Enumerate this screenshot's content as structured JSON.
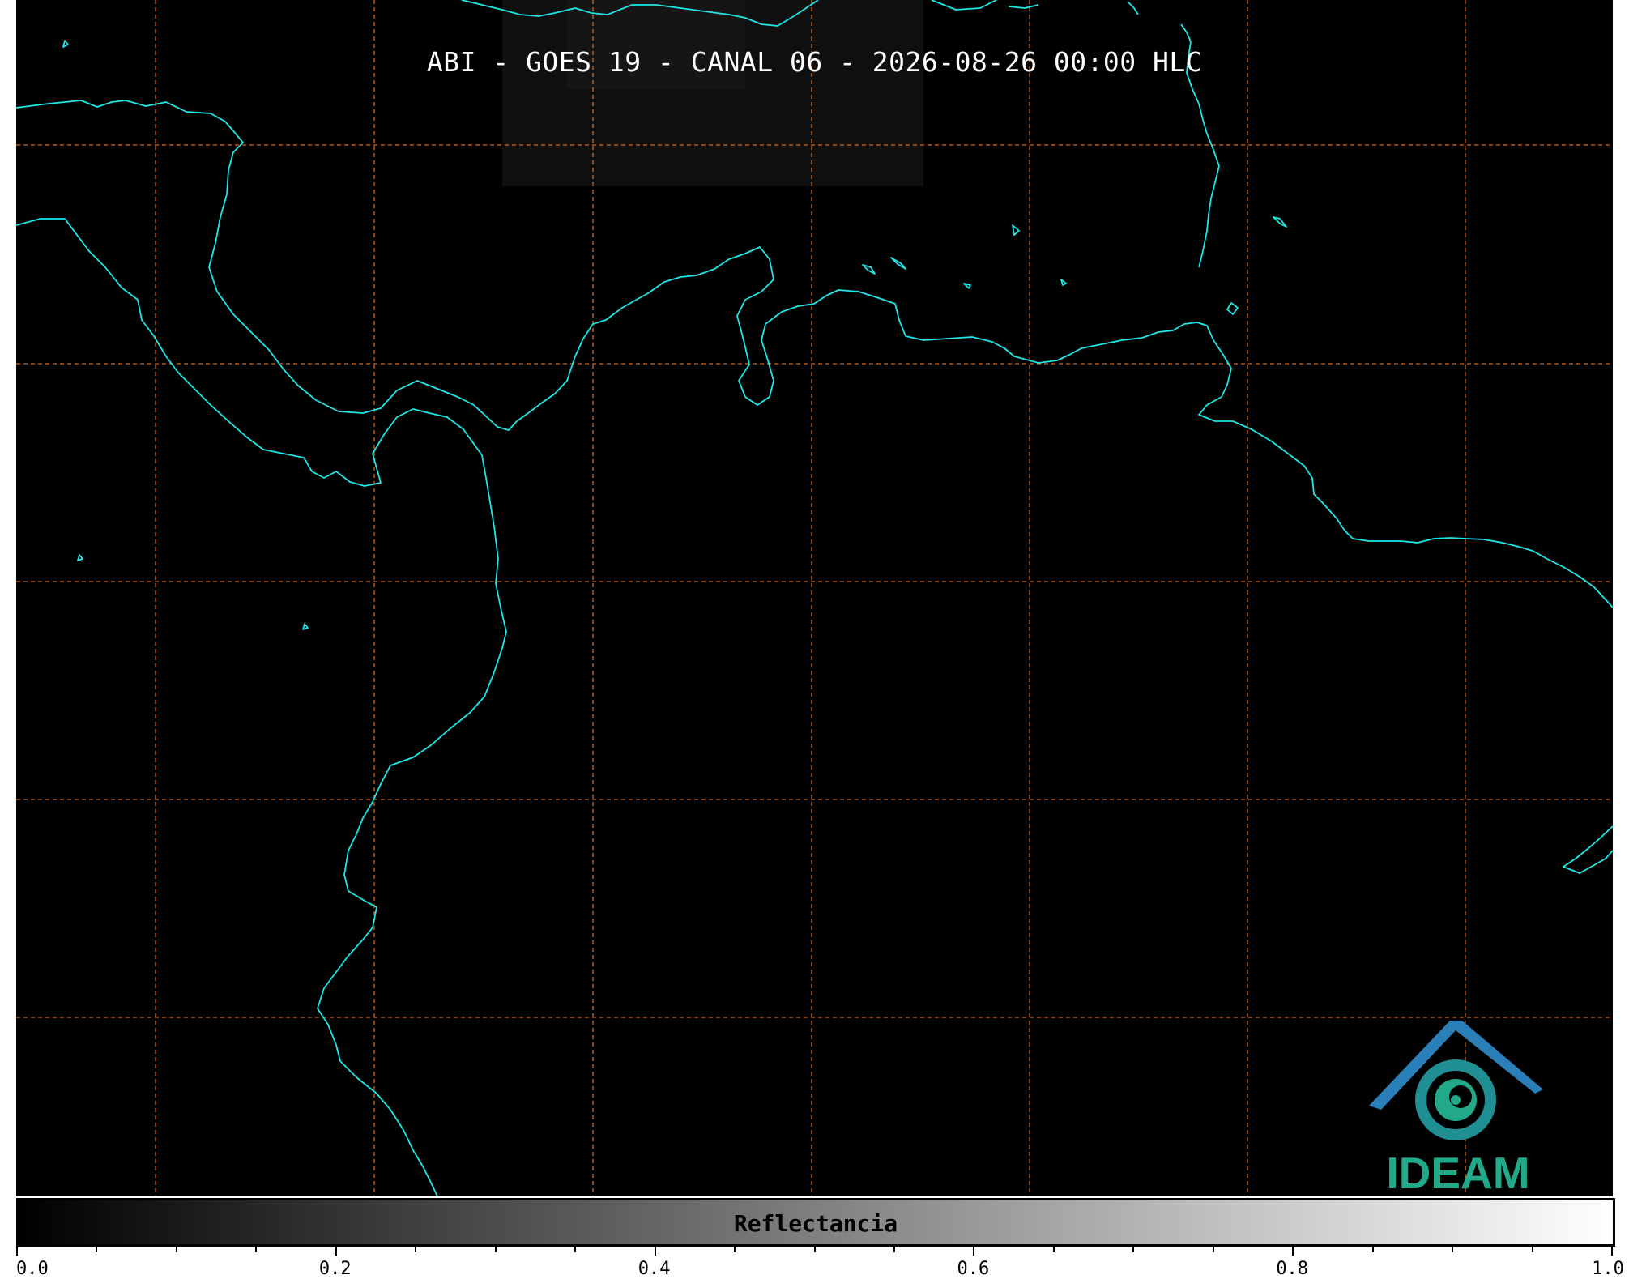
{
  "title": "ABI - GOES 19 - CANAL 06 - 2026-08-26 00:00 HLC",
  "colorbar": {
    "label": "Reflectancia",
    "ticks": [
      "0.0",
      "0.2",
      "0.4",
      "0.6",
      "0.8",
      "1.0"
    ],
    "range": [
      0.0,
      1.0
    ],
    "colormap": [
      "#000000",
      "#ffffff"
    ]
  },
  "logo": {
    "text": "IDEAM"
  },
  "colors": {
    "coastline": "#1ee6e6",
    "gridlines": "#d2691e",
    "background": "#000000",
    "logo_green": "#22a98a",
    "logo_blue": "#2a7fb8"
  },
  "map": {
    "gridline_style": "dashed"
  }
}
